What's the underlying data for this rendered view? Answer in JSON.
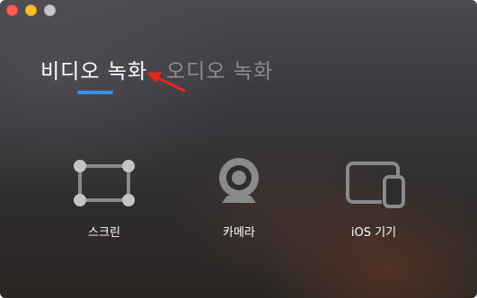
{
  "window": {
    "controls": [
      "close",
      "minimize",
      "maximize"
    ]
  },
  "tabs": [
    {
      "label": "비디오 녹화",
      "active": true
    },
    {
      "label": "오디오 녹화",
      "active": false
    }
  ],
  "sources": [
    {
      "label": "스크린",
      "icon": "screen-region-icon"
    },
    {
      "label": "카메라",
      "icon": "webcam-icon"
    },
    {
      "label": "iOS 기기",
      "icon": "ios-device-icon"
    }
  ],
  "colors": {
    "accent": "#3f8de8",
    "annotation_arrow": "#e8241c",
    "icon_gray": "#8a8a8c",
    "text_active": "#ffffff",
    "text_inactive": "#8f8b8c"
  }
}
